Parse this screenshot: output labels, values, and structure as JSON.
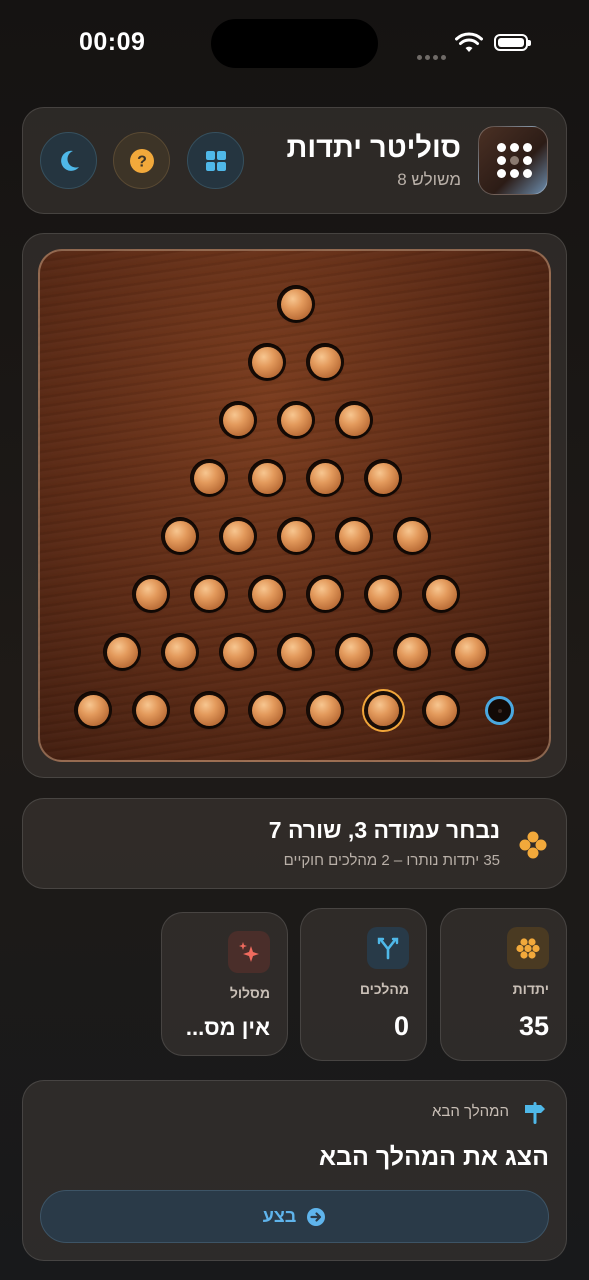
{
  "status_bar": {
    "time": "00:09"
  },
  "header": {
    "title": "סוליטר יתדות",
    "subtitle": "משולש 8",
    "icons": {
      "app": "peg-grid-app-icon",
      "layout": "grid-icon",
      "help": "question-icon",
      "theme": "moon-icon"
    },
    "accent_colors": {
      "blue": "#4fb8e8",
      "amber": "#f2a93b"
    }
  },
  "board": {
    "shape": "triangle",
    "rows": 8,
    "selected": {
      "row": 7,
      "col": 5
    },
    "empty_target": {
      "row": 7,
      "col": 7
    },
    "peg_color": "#e39a5c",
    "selection_color": "#f0a53a",
    "target_color": "#4aa8e0"
  },
  "info": {
    "title": "נבחר עמודה 3, שורה 7",
    "subtitle": "35 יתדות נותרו – 2 מהלכים חוקיים"
  },
  "stats": [
    {
      "label": "יתדות",
      "value": "35",
      "icon": "pegs-icon"
    },
    {
      "label": "מהלכים",
      "value": "0",
      "icon": "branch-icon"
    },
    {
      "label": "מסלול",
      "value": "אין מס...",
      "icon": "sparkle-icon"
    }
  ],
  "next_move": {
    "header": "המהלך הבא",
    "title": "הצג את המהלך הבא",
    "button_label": "בצע"
  }
}
